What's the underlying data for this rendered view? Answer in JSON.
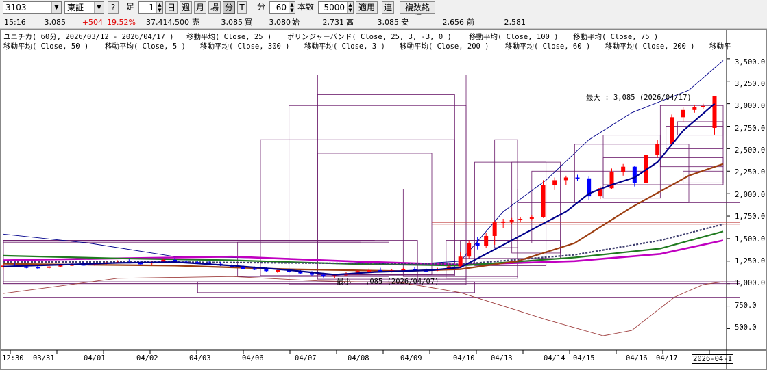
{
  "toolbar": {
    "code": "3103",
    "market": "東証",
    "help": "?",
    "ashi_label": "足",
    "spin_value": "1",
    "periods": [
      "日",
      "週",
      "月",
      "場",
      "分",
      "T"
    ],
    "minute_label": "分",
    "minute_value": "60",
    "count_label": "本数",
    "count_value": "5000",
    "apply": "適用",
    "ren": "連",
    "multi": "複数銘柄"
  },
  "quote": {
    "time": "15:16",
    "price": "3,085",
    "change": "+504",
    "change_pct": "19.52%",
    "volume": "37,414,500",
    "sell_label": "売",
    "sell": "3,085",
    "buy_label": "買",
    "buy": "3,080",
    "open_label": "始",
    "open": "2,731",
    "high_label": "高",
    "high": "3,085",
    "low_label": "安",
    "low": "2,656",
    "prev_label": "前",
    "prev": "2,581",
    "colors": {
      "up": "#ff0000",
      "down": "#0000ff"
    }
  },
  "legend": {
    "line1": [
      "ユニチカ( 60分, 2026/03/12 - 2026/04/17 )",
      "移動平均( Close, 25 )",
      "ボリンジャーバンド( Close, 25, 3, -3, 0 )",
      "移動平均( Close, 100 )",
      "移動平均( Close, 75 )"
    ],
    "line2": [
      "移動平均( Close, 50 )",
      "移動平均( Close, 5 )",
      "移動平均( Close, 300 )",
      "移動平均( Close, 3 )",
      "移動平均( Close, 200 )",
      "移動平均( Close, 60 )",
      "移動平均( Close, 200 )",
      "移動平"
    ]
  },
  "annotations": {
    "max": "最大 : 3,085 (2026/04/17)",
    "min_prefix": "最小",
    "min": ",085 (2026/04/07)"
  },
  "chart_data": {
    "type": "candlestick",
    "x_tick_labels": [
      "12:30",
      "03/31",
      "04/01",
      "04/02",
      "04/03",
      "04/06",
      "04/07",
      "04/08",
      "04/09",
      "04/10",
      "04/13",
      "04/14",
      "04/15",
      "04/16",
      "04/17",
      "2026-04-1"
    ],
    "y_tick_labels": [
      "3,500.0",
      "3,250.0",
      "3,000.0",
      "2,750.0",
      "2,500.0",
      "2,250.0",
      "2,000.0",
      "1,750.0",
      "1,500.0",
      "1,250.0",
      "1,000.0",
      "750.0",
      "500.0"
    ],
    "y_ticks": [
      3500,
      3250,
      3000,
      2750,
      2500,
      2250,
      2000,
      1750,
      1500,
      1250,
      1000,
      750,
      500
    ],
    "ylim": [
      260,
      3575
    ],
    "grid": false,
    "series_colors": {
      "ma25": "#00008b",
      "ma100": "#9c3d10",
      "ma75": "#1f7a1f",
      "ma50": "#c000c0",
      "ma300": "#404070",
      "bollinger": "#00008b",
      "lower_band": "#a04040",
      "boxes": "#6a1a6a"
    },
    "candles": [
      [
        0,
        1180,
        1215,
        1165,
        1200
      ],
      [
        4,
        1200,
        1225,
        1185,
        1190
      ],
      [
        8,
        1190,
        1210,
        1170,
        1185
      ],
      [
        12,
        1185,
        1200,
        1160,
        1175
      ],
      [
        16,
        1175,
        1195,
        1160,
        1190
      ],
      [
        20,
        1190,
        1215,
        1180,
        1205
      ],
      [
        24,
        1205,
        1230,
        1195,
        1215
      ],
      [
        28,
        1215,
        1240,
        1200,
        1210
      ],
      [
        32,
        1210,
        1230,
        1195,
        1220
      ],
      [
        36,
        1220,
        1245,
        1210,
        1235
      ],
      [
        40,
        1235,
        1260,
        1225,
        1240
      ],
      [
        44,
        1240,
        1270,
        1225,
        1230
      ],
      [
        48,
        1230,
        1250,
        1210,
        1225
      ],
      [
        52,
        1225,
        1250,
        1210,
        1240
      ],
      [
        56,
        1240,
        1275,
        1230,
        1265
      ],
      [
        60,
        1265,
        1285,
        1235,
        1245
      ],
      [
        64,
        1245,
        1265,
        1225,
        1240
      ],
      [
        68,
        1240,
        1255,
        1220,
        1235
      ],
      [
        72,
        1235,
        1250,
        1210,
        1220
      ],
      [
        76,
        1220,
        1240,
        1195,
        1205
      ],
      [
        80,
        1205,
        1220,
        1175,
        1180
      ],
      [
        84,
        1180,
        1200,
        1160,
        1170
      ],
      [
        88,
        1170,
        1190,
        1150,
        1160
      ],
      [
        92,
        1160,
        1180,
        1130,
        1140
      ],
      [
        96,
        1140,
        1165,
        1120,
        1150
      ],
      [
        100,
        1150,
        1165,
        1120,
        1130
      ],
      [
        104,
        1130,
        1150,
        1105,
        1120
      ],
      [
        108,
        1120,
        1140,
        1090,
        1100
      ],
      [
        112,
        1100,
        1120,
        1070,
        1080
      ],
      [
        116,
        1080,
        1110,
        1060,
        1100
      ],
      [
        120,
        1100,
        1130,
        1085,
        1110
      ],
      [
        124,
        1110,
        1150,
        1100,
        1140
      ],
      [
        128,
        1140,
        1170,
        1120,
        1150
      ],
      [
        132,
        1150,
        1175,
        1130,
        1145
      ],
      [
        136,
        1145,
        1165,
        1125,
        1150
      ],
      [
        140,
        1150,
        1175,
        1130,
        1160
      ],
      [
        144,
        1160,
        1180,
        1140,
        1150
      ],
      [
        148,
        1150,
        1170,
        1130,
        1145
      ],
      [
        152,
        1145,
        1175,
        1140,
        1160
      ],
      [
        156,
        1160,
        1200,
        1150,
        1190
      ],
      [
        160,
        1190,
        1350,
        1180,
        1300
      ],
      [
        163,
        1300,
        1480,
        1280,
        1450
      ],
      [
        166,
        1450,
        1520,
        1380,
        1420
      ],
      [
        169,
        1420,
        1560,
        1400,
        1530
      ],
      [
        172,
        1530,
        1700,
        1430,
        1680
      ],
      [
        175,
        1680,
        1720,
        1620,
        1690
      ],
      [
        178,
        1690,
        1730,
        1660,
        1710
      ],
      [
        181,
        1710,
        1740,
        1680,
        1720
      ],
      [
        185,
        1720,
        1760,
        1700,
        1740
      ],
      [
        189,
        1740,
        2150,
        1730,
        2100
      ],
      [
        193,
        2100,
        2180,
        2040,
        2150
      ],
      [
        197,
        2150,
        2200,
        2100,
        2180
      ],
      [
        201,
        2180,
        2210,
        2140,
        2170
      ],
      [
        205,
        2170,
        2190,
        1930,
        1970
      ],
      [
        209,
        1970,
        2080,
        1940,
        2060
      ],
      [
        213,
        2060,
        2280,
        2050,
        2240
      ],
      [
        217,
        2240,
        2330,
        2200,
        2300
      ],
      [
        221,
        2300,
        2310,
        2080,
        2120
      ],
      [
        225,
        2120,
        2460,
        2100,
        2430
      ],
      [
        229,
        2430,
        2600,
        2400,
        2550
      ],
      [
        234,
        2550,
        2880,
        2530,
        2850
      ],
      [
        238,
        2850,
        2960,
        2800,
        2930
      ],
      [
        242,
        2930,
        2990,
        2900,
        2960
      ],
      [
        245,
        2960,
        3000,
        2940,
        2975
      ],
      [
        249,
        2731,
        3085,
        2656,
        3085
      ]
    ],
    "ma25": [
      [
        0,
        1190
      ],
      [
        20,
        1210
      ],
      [
        40,
        1230
      ],
      [
        60,
        1240
      ],
      [
        80,
        1200
      ],
      [
        100,
        1150
      ],
      [
        116,
        1100
      ],
      [
        130,
        1130
      ],
      [
        150,
        1150
      ],
      [
        160,
        1180
      ],
      [
        172,
        1380
      ],
      [
        185,
        1600
      ],
      [
        197,
        1800
      ],
      [
        205,
        2000
      ],
      [
        213,
        2100
      ],
      [
        221,
        2180
      ],
      [
        229,
        2350
      ],
      [
        238,
        2700
      ],
      [
        249,
        3000
      ]
    ],
    "ma100": [
      [
        0,
        1220
      ],
      [
        30,
        1210
      ],
      [
        60,
        1200
      ],
      [
        100,
        1160
      ],
      [
        140,
        1140
      ],
      [
        160,
        1160
      ],
      [
        180,
        1250
      ],
      [
        200,
        1450
      ],
      [
        220,
        1850
      ],
      [
        240,
        2200
      ],
      [
        252,
        2330
      ]
    ],
    "ma75": [
      [
        0,
        1310
      ],
      [
        40,
        1280
      ],
      [
        80,
        1260
      ],
      [
        120,
        1220
      ],
      [
        160,
        1200
      ],
      [
        200,
        1290
      ],
      [
        230,
        1390
      ],
      [
        252,
        1580
      ]
    ],
    "ma50": [
      [
        0,
        1260
      ],
      [
        40,
        1280
      ],
      [
        80,
        1300
      ],
      [
        120,
        1250
      ],
      [
        160,
        1210
      ],
      [
        200,
        1250
      ],
      [
        230,
        1330
      ],
      [
        252,
        1480
      ]
    ],
    "ma300": [
      [
        0,
        1240
      ],
      [
        60,
        1240
      ],
      [
        120,
        1225
      ],
      [
        160,
        1215
      ],
      [
        200,
        1320
      ],
      [
        230,
        1480
      ],
      [
        252,
        1660
      ]
    ],
    "bb_upper": [
      [
        0,
        1550
      ],
      [
        30,
        1450
      ],
      [
        60,
        1300
      ],
      [
        100,
        1280
      ],
      [
        140,
        1210
      ],
      [
        160,
        1250
      ],
      [
        175,
        1800
      ],
      [
        190,
        2150
      ],
      [
        205,
        2600
      ],
      [
        220,
        2900
      ],
      [
        240,
        3150
      ],
      [
        252,
        3480
      ]
    ],
    "bb_lower": [
      [
        0,
        890
      ],
      [
        40,
        1060
      ],
      [
        80,
        1080
      ],
      [
        110,
        1030
      ],
      [
        140,
        1010
      ],
      [
        160,
        900
      ],
      [
        190,
        600
      ],
      [
        210,
        420
      ],
      [
        220,
        480
      ],
      [
        235,
        850
      ],
      [
        245,
        990
      ],
      [
        252,
        1020
      ]
    ]
  }
}
